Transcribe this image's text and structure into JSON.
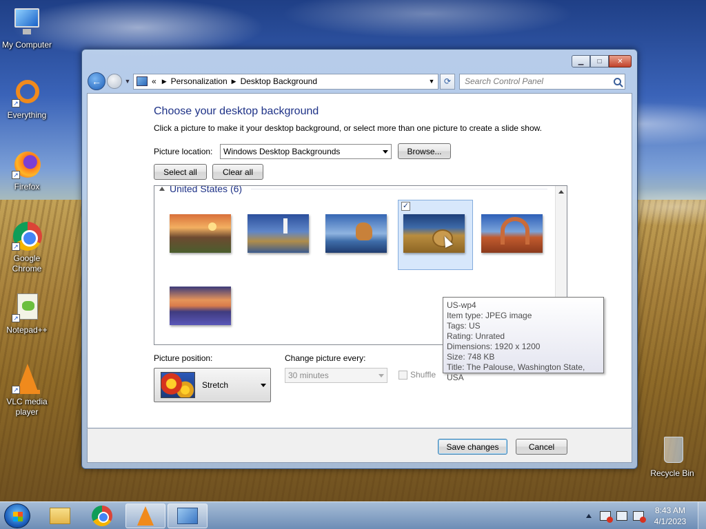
{
  "desktop": {
    "icons": [
      {
        "label": "My Computer"
      },
      {
        "label": "Everything"
      },
      {
        "label": "Firefox"
      },
      {
        "label": "Google Chrome"
      },
      {
        "label": "Notepad++"
      },
      {
        "label": "VLC media player"
      },
      {
        "label": "Recycle Bin"
      }
    ]
  },
  "window": {
    "breadcrumb": {
      "overflow": "«",
      "items": [
        "Personalization",
        "Desktop Background"
      ]
    },
    "search": {
      "placeholder": "Search Control Panel"
    },
    "heading": "Choose your desktop background",
    "instructions": "Click a picture to make it your desktop background, or select more than one picture to create a slide show.",
    "picture_location": {
      "label": "Picture location:",
      "value": "Windows Desktop Backgrounds",
      "browse_label": "Browse..."
    },
    "select_all_label": "Select all",
    "clear_all_label": "Clear all",
    "gallery": {
      "group_header": "United States (6)",
      "thumbnail_count": 6,
      "selected_index": 3
    },
    "tooltip": {
      "lines": [
        "US-wp4",
        "Item type: JPEG image",
        "Tags: US",
        "Rating: Unrated",
        "Dimensions: 1920 x 1200",
        "Size: 748 KB",
        "Title: The Palouse, Washington State, USA"
      ]
    },
    "picture_position": {
      "label": "Picture position:",
      "value": "Stretch"
    },
    "change_picture": {
      "label": "Change picture every:",
      "value": "30 minutes",
      "disabled": true
    },
    "shuffle": {
      "label": "Shuffle",
      "checked": false,
      "disabled": true
    },
    "save_label": "Save changes",
    "cancel_label": "Cancel"
  },
  "taskbar": {
    "pinned": [
      "Windows Explorer",
      "Google Chrome",
      "VLC media player",
      "Control Panel"
    ],
    "active": "Control Panel",
    "clock": {
      "time": "8:43 AM",
      "date": "4/1/2023"
    }
  },
  "colors": {
    "heading": "#1e3287",
    "selection": "#d7e7fb",
    "taskbar": "#8aa9d0"
  }
}
